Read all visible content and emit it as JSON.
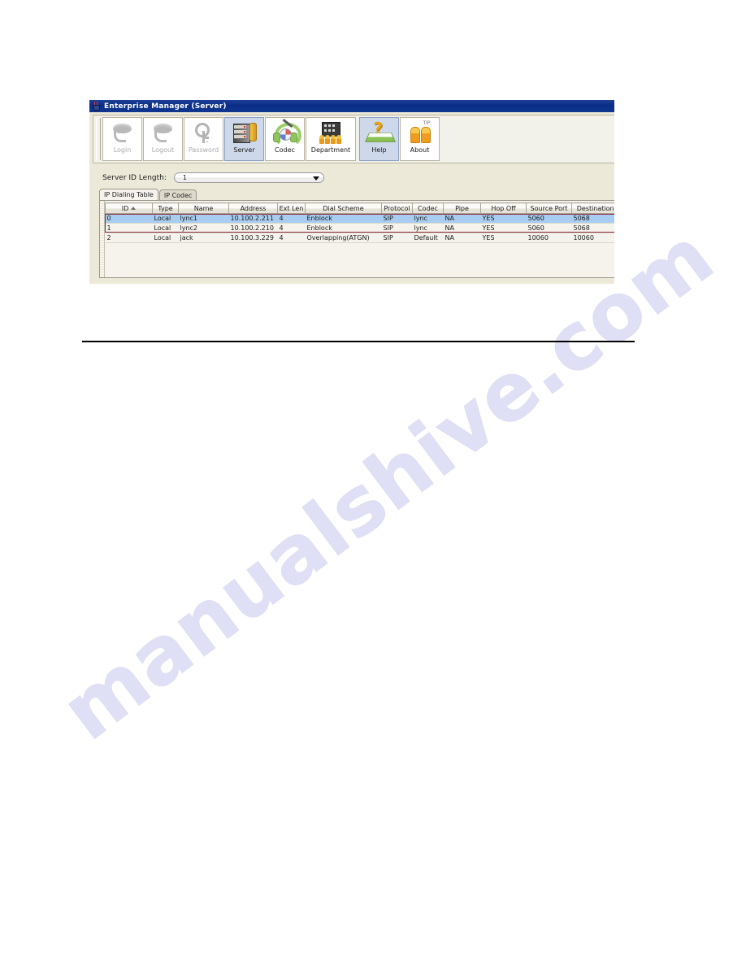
{
  "window": {
    "title": "Enterprise Manager  (Server)",
    "icon": "java-cup-icon"
  },
  "toolbar": {
    "buttons": [
      {
        "label": "Login",
        "icon": "login-icon",
        "state": "disabled"
      },
      {
        "label": "Logout",
        "icon": "logout-icon",
        "state": "disabled"
      },
      {
        "label": "Password",
        "icon": "key-icon",
        "state": "disabled"
      },
      {
        "label": "Server",
        "icon": "server-rack-icon",
        "state": "selected"
      },
      {
        "label": "Codec",
        "icon": "headphones-icon",
        "state": "normal"
      },
      {
        "label": "Department",
        "icon": "building-people-icon",
        "state": "normal"
      },
      {
        "label": "Help",
        "icon": "help-book-icon",
        "state": "normal"
      },
      {
        "label": "About",
        "icon": "about-people-icon",
        "state": "normal"
      }
    ]
  },
  "form": {
    "id_length_label": "Server ID Length:",
    "id_length_value": "1"
  },
  "tabs": [
    {
      "label": "IP Dialing Table",
      "active": true
    },
    {
      "label": "IP Codec",
      "active": false
    }
  ],
  "table": {
    "headers": [
      "ID",
      "Type",
      "Name",
      "Address",
      "Ext Len",
      "Dial Scheme",
      "Protocol",
      "Codec",
      "Pipe",
      "Hop Off",
      "Source Port",
      "Destination .."
    ],
    "sort_column": "ID",
    "rows": [
      {
        "id": "0",
        "type": "Local",
        "name": "lync1",
        "address": "10.100.2.211",
        "ext_len": "4",
        "dial_scheme": "Enblock",
        "protocol": "SIP",
        "codec": "lync",
        "pipe": "NA",
        "hop_off": "YES",
        "source_port": "5060",
        "destination_port": "5068",
        "selected": true
      },
      {
        "id": "1",
        "type": "Local",
        "name": "lync2",
        "address": "10.100.2.210",
        "ext_len": "4",
        "dial_scheme": "Enblock",
        "protocol": "SIP",
        "codec": "lync",
        "pipe": "NA",
        "hop_off": "YES",
        "source_port": "5060",
        "destination_port": "5068",
        "selected": false
      },
      {
        "id": "2",
        "type": "Local",
        "name": "jack",
        "address": "10.100.3.229",
        "ext_len": "4",
        "dial_scheme": "Overlapping(ATGN)",
        "protocol": "SIP",
        "codec": "Default",
        "pipe": "NA",
        "hop_off": "YES",
        "source_port": "10060",
        "destination_port": "10060",
        "selected": false
      }
    ],
    "highlight_color": "#8b2b3a",
    "selection_color": "#a8cdf0"
  },
  "page": {
    "watermark": "manualshive.com"
  }
}
